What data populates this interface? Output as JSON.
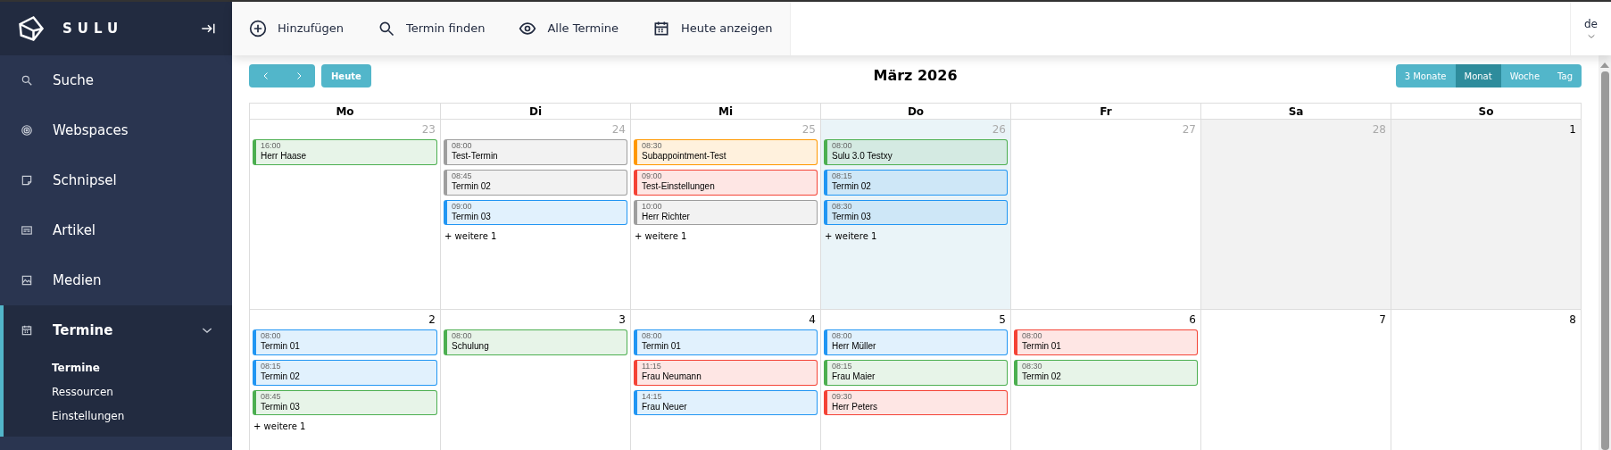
{
  "sidebar": {
    "logo": "SULU",
    "items": [
      {
        "label": "Suche",
        "selected": false
      },
      {
        "label": "Webspaces",
        "selected": false
      },
      {
        "label": "Schnipsel",
        "selected": false
      },
      {
        "label": "Artikel",
        "selected": false
      },
      {
        "label": "Medien",
        "selected": false
      },
      {
        "label": "Termine",
        "selected": true,
        "expanded": true,
        "children": [
          {
            "label": "Termine",
            "selected": true
          },
          {
            "label": "Ressourcen",
            "selected": false
          },
          {
            "label": "Einstellungen",
            "selected": false
          }
        ]
      }
    ]
  },
  "toolbar": {
    "buttons": [
      "Hinzufügen",
      "Termin finden",
      "Alle Termine",
      "Heute anzeigen"
    ],
    "locale": "de"
  },
  "calendar": {
    "title": "März 2026",
    "today_button": "Heute",
    "views": [
      {
        "label": "3 Monate",
        "selected": false
      },
      {
        "label": "Monat",
        "selected": true
      },
      {
        "label": "Woche",
        "selected": false
      },
      {
        "label": "Tag",
        "selected": false
      }
    ],
    "weekdays": [
      "Mo",
      "Di",
      "Mi",
      "Do",
      "Fr",
      "Sa",
      "So"
    ],
    "weeks": [
      {
        "days": [
          {
            "date": "23",
            "other_month": true,
            "kind": "plain",
            "events": [
              {
                "time": "16:00",
                "title": "Herr Haase",
                "color": "#4caf50"
              }
            ]
          },
          {
            "date": "24",
            "other_month": true,
            "kind": "plain",
            "events": [
              {
                "time": "08:00",
                "title": "Test-Termin",
                "color": "#9e9e9e"
              },
              {
                "time": "08:45",
                "title": "Termin 02",
                "color": "#9e9e9e"
              },
              {
                "time": "09:00",
                "title": "Termin 03",
                "color": "#2196f3"
              }
            ],
            "more": "+ weitere 1"
          },
          {
            "date": "25",
            "other_month": true,
            "kind": "plain",
            "events": [
              {
                "time": "08:30",
                "title": "Subappointment-Test",
                "color": "#ff9800"
              },
              {
                "time": "09:00",
                "title": "Test-Einstellungen",
                "color": "#f44336"
              },
              {
                "time": "10:00",
                "title": "Herr Richter",
                "color": "#9e9e9e"
              }
            ],
            "more": "+ weitere 1"
          },
          {
            "date": "26",
            "other_month": true,
            "kind": "today",
            "events": [
              {
                "time": "08:00",
                "title": "Sulu 3.0 Testxy",
                "color": "#4caf50"
              },
              {
                "time": "08:15",
                "title": "Termin 02",
                "color": "#2196f3"
              },
              {
                "time": "08:30",
                "title": "Termin 03",
                "color": "#2196f3"
              }
            ],
            "more": "+ weitere 1"
          },
          {
            "date": "27",
            "other_month": true,
            "kind": "plain"
          },
          {
            "date": "28",
            "other_month": true,
            "kind": "shaded"
          },
          {
            "date": "1",
            "other_month": false,
            "kind": "shaded"
          }
        ]
      },
      {
        "days": [
          {
            "date": "2",
            "other_month": false,
            "kind": "plain",
            "events": [
              {
                "time": "08:00",
                "title": "Termin 01",
                "color": "#2196f3"
              },
              {
                "time": "08:15",
                "title": "Termin 02",
                "color": "#2196f3"
              },
              {
                "time": "08:45",
                "title": "Termin 03",
                "color": "#4caf50"
              }
            ],
            "more": "+ weitere 1"
          },
          {
            "date": "3",
            "other_month": false,
            "kind": "plain",
            "events": [
              {
                "time": "08:00",
                "title": "Schulung",
                "color": "#4caf50"
              }
            ]
          },
          {
            "date": "4",
            "other_month": false,
            "kind": "plain",
            "events": [
              {
                "time": "08:00",
                "title": "Termin 01",
                "color": "#2196f3"
              },
              {
                "time": "11:15",
                "title": "Frau Neumann",
                "color": "#f44336"
              },
              {
                "time": "14:15",
                "title": "Frau Neuer",
                "color": "#2196f3"
              }
            ]
          },
          {
            "date": "5",
            "other_month": false,
            "kind": "plain",
            "events": [
              {
                "time": "08:00",
                "title": "Herr Müller",
                "color": "#2196f3"
              },
              {
                "time": "08:15",
                "title": "Frau Maier",
                "color": "#4caf50"
              },
              {
                "time": "09:30",
                "title": "Herr Peters",
                "color": "#f44336"
              }
            ]
          },
          {
            "date": "6",
            "other_month": false,
            "kind": "plain",
            "events": [
              {
                "time": "08:00",
                "title": "Termin 01",
                "color": "#f44336"
              },
              {
                "time": "08:30",
                "title": "Termin 02",
                "color": "#4caf50"
              }
            ]
          },
          {
            "date": "7",
            "other_month": false,
            "kind": "plain"
          },
          {
            "date": "8",
            "other_month": false,
            "kind": "plain"
          }
        ]
      }
    ]
  }
}
